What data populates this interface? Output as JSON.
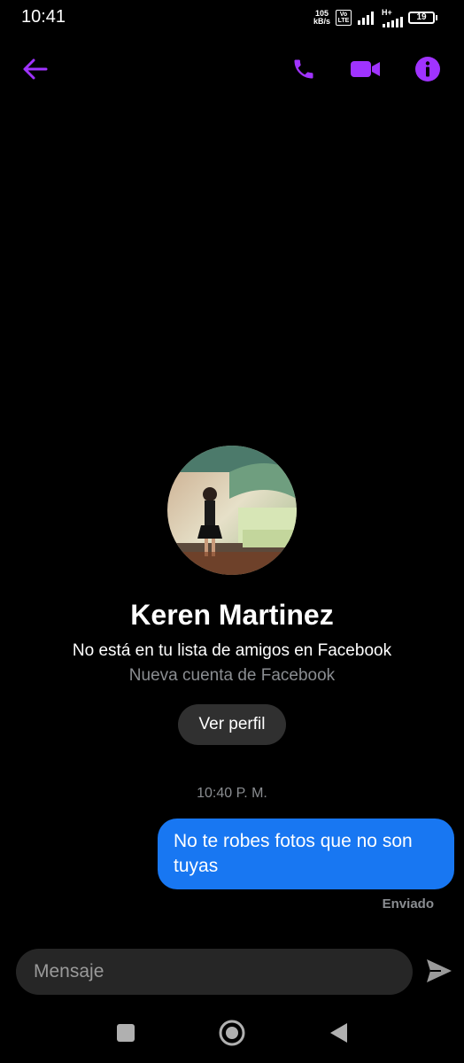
{
  "status_bar": {
    "time": "10:41",
    "speed_value": "105",
    "speed_unit": "kB/s",
    "volte_top": "Vo",
    "volte_bottom": "LTE",
    "network_type": "H+",
    "battery_level": "19"
  },
  "header": {
    "back_icon": "arrow-left-icon",
    "call_icon": "phone-icon",
    "video_icon": "video-camera-icon",
    "info_icon": "info-icon"
  },
  "profile": {
    "name": "Keren Martinez",
    "friend_note": "No está en tu lista de amigos en Facebook",
    "account_note": "Nueva cuenta de Facebook",
    "view_profile_label": "Ver perfil"
  },
  "conversation": {
    "timestamp": "10:40 P. M.",
    "messages": [
      {
        "text": "No te robes fotos que no son tuyas",
        "status": "Enviado"
      }
    ]
  },
  "composer": {
    "placeholder": "Mensaje",
    "send_icon": "send-icon"
  },
  "colors": {
    "accent": "#a033ff",
    "bubble": "#1877f2",
    "muted_text": "#8a8d91",
    "composer_bg": "#262626",
    "button_bg": "#303030"
  }
}
